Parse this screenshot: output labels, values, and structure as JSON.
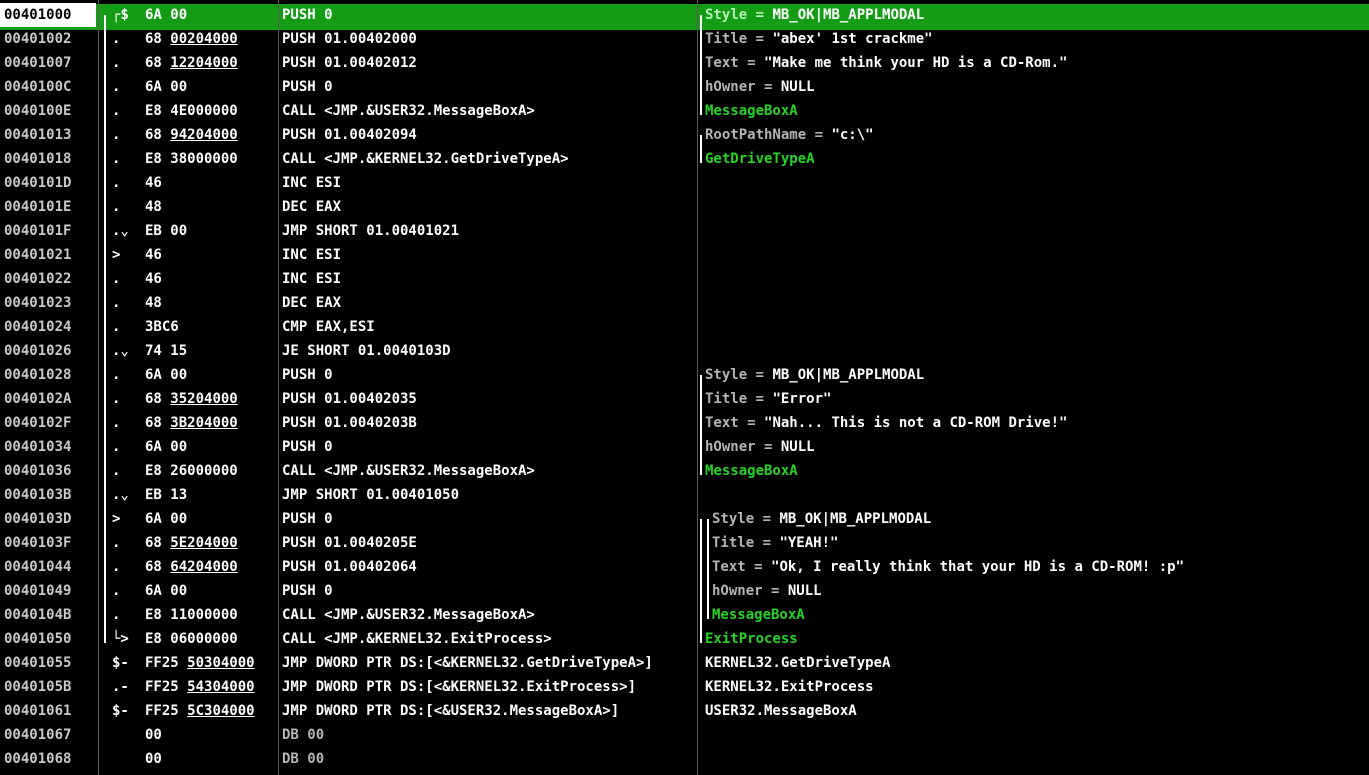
{
  "rows": [
    {
      "addr": "00401000",
      "mark": "┌$",
      "hex": "6A 00",
      "hex_u": "",
      "cmd": "PUSH 0",
      "cmt_param": "Style = ",
      "cmt_val": "MB_OK|MB_APPLMODAL",
      "cmt_fn": "",
      "selected": true
    },
    {
      "addr": "00401002",
      "mark": ".",
      "hex": "68 ",
      "hex_u": "00204000",
      "cmd": "PUSH 01.00402000",
      "cmt_param": "Title = ",
      "cmt_val": "\"abex' 1st crackme\"",
      "cmt_fn": ""
    },
    {
      "addr": "00401007",
      "mark": ".",
      "hex": "68 ",
      "hex_u": "12204000",
      "cmd": "PUSH 01.00402012",
      "cmt_param": "Text = ",
      "cmt_val": "\"Make me think your HD is a CD-Rom.\"",
      "cmt_fn": ""
    },
    {
      "addr": "0040100C",
      "mark": ".",
      "hex": "6A 00",
      "hex_u": "",
      "cmd": "PUSH 0",
      "cmt_param": "hOwner = ",
      "cmt_val": "NULL",
      "cmt_fn": ""
    },
    {
      "addr": "0040100E",
      "mark": ".",
      "hex": "E8 4E000000",
      "hex_u": "",
      "cmd": "CALL <JMP.&USER32.MessageBoxA>",
      "cmt_param": "",
      "cmt_val": "",
      "cmt_fn": "MessageBoxA"
    },
    {
      "addr": "00401013",
      "mark": ".",
      "hex": "68 ",
      "hex_u": "94204000",
      "cmd": "PUSH 01.00402094",
      "cmt_param": "RootPathName = ",
      "cmt_val": "\"c:\\\"",
      "cmt_fn": ""
    },
    {
      "addr": "00401018",
      "mark": ".",
      "hex": "E8 38000000",
      "hex_u": "",
      "cmd": "CALL <JMP.&KERNEL32.GetDriveTypeA>",
      "cmt_param": "",
      "cmt_val": "",
      "cmt_fn": "GetDriveTypeA"
    },
    {
      "addr": "0040101D",
      "mark": ".",
      "hex": "46",
      "hex_u": "",
      "cmd": "INC ESI",
      "cmt_param": "",
      "cmt_val": "",
      "cmt_fn": ""
    },
    {
      "addr": "0040101E",
      "mark": ".",
      "hex": "48",
      "hex_u": "",
      "cmd": "DEC EAX",
      "cmt_param": "",
      "cmt_val": "",
      "cmt_fn": ""
    },
    {
      "addr": "0040101F",
      "mark": ".⌄",
      "hex": "EB 00",
      "hex_u": "",
      "cmd": "JMP SHORT 01.00401021",
      "cmt_param": "",
      "cmt_val": "",
      "cmt_fn": ""
    },
    {
      "addr": "00401021",
      "mark": ">",
      "hex": "46",
      "hex_u": "",
      "cmd": "INC ESI",
      "cmt_param": "",
      "cmt_val": "",
      "cmt_fn": ""
    },
    {
      "addr": "00401022",
      "mark": ".",
      "hex": "46",
      "hex_u": "",
      "cmd": "INC ESI",
      "cmt_param": "",
      "cmt_val": "",
      "cmt_fn": ""
    },
    {
      "addr": "00401023",
      "mark": ".",
      "hex": "48",
      "hex_u": "",
      "cmd": "DEC EAX",
      "cmt_param": "",
      "cmt_val": "",
      "cmt_fn": ""
    },
    {
      "addr": "00401024",
      "mark": ".",
      "hex": "3BC6",
      "hex_u": "",
      "cmd": "CMP EAX,ESI",
      "cmt_param": "",
      "cmt_val": "",
      "cmt_fn": ""
    },
    {
      "addr": "00401026",
      "mark": ".⌄",
      "hex": "74 15",
      "hex_u": "",
      "cmd": "JE SHORT 01.0040103D",
      "cmt_param": "",
      "cmt_val": "",
      "cmt_fn": ""
    },
    {
      "addr": "00401028",
      "mark": ".",
      "hex": "6A 00",
      "hex_u": "",
      "cmd": "PUSH 0",
      "cmt_param": "Style = ",
      "cmt_val": "MB_OK|MB_APPLMODAL",
      "cmt_fn": ""
    },
    {
      "addr": "0040102A",
      "mark": ".",
      "hex": "68 ",
      "hex_u": "35204000",
      "cmd": "PUSH 01.00402035",
      "cmt_param": "Title = ",
      "cmt_val": "\"Error\"",
      "cmt_fn": ""
    },
    {
      "addr": "0040102F",
      "mark": ".",
      "hex": "68 ",
      "hex_u": "3B204000",
      "cmd": "PUSH 01.0040203B",
      "cmt_param": "Text = ",
      "cmt_val": "\"Nah... This is not a CD-ROM Drive!\"",
      "cmt_fn": ""
    },
    {
      "addr": "00401034",
      "mark": ".",
      "hex": "6A 00",
      "hex_u": "",
      "cmd": "PUSH 0",
      "cmt_param": "hOwner = ",
      "cmt_val": "NULL",
      "cmt_fn": ""
    },
    {
      "addr": "00401036",
      "mark": ".",
      "hex": "E8 26000000",
      "hex_u": "",
      "cmd": "CALL <JMP.&USER32.MessageBoxA>",
      "cmt_param": "",
      "cmt_val": "",
      "cmt_fn": "MessageBoxA"
    },
    {
      "addr": "0040103B",
      "mark": ".⌄",
      "hex": "EB 13",
      "hex_u": "",
      "cmd": "JMP SHORT 01.00401050",
      "cmt_param": "",
      "cmt_val": "",
      "cmt_fn": ""
    },
    {
      "addr": "0040103D",
      "mark": ">",
      "hex": "6A 00",
      "hex_u": "",
      "cmd": "PUSH 0",
      "cmt_param": "Style = ",
      "cmt_val": "MB_OK|MB_APPLMODAL",
      "cmt_fn": ""
    },
    {
      "addr": "0040103F",
      "mark": ".",
      "hex": "68 ",
      "hex_u": "5E204000",
      "cmd": "PUSH 01.0040205E",
      "cmt_param": "Title = ",
      "cmt_val": "\"YEAH!\"",
      "cmt_fn": ""
    },
    {
      "addr": "00401044",
      "mark": ".",
      "hex": "68 ",
      "hex_u": "64204000",
      "cmd": "PUSH 01.00402064",
      "cmt_param": "Text = ",
      "cmt_val": "\"Ok, I really think that your HD is a CD-ROM! :p\"",
      "cmt_fn": ""
    },
    {
      "addr": "00401049",
      "mark": ".",
      "hex": "6A 00",
      "hex_u": "",
      "cmd": "PUSH 0",
      "cmt_param": "hOwner = ",
      "cmt_val": "NULL",
      "cmt_fn": ""
    },
    {
      "addr": "0040104B",
      "mark": ".",
      "hex": "E8 11000000",
      "hex_u": "",
      "cmd": "CALL <JMP.&USER32.MessageBoxA>",
      "cmt_param": "",
      "cmt_val": "",
      "cmt_fn": "MessageBoxA"
    },
    {
      "addr": "00401050",
      "mark": "└>",
      "hex": "E8 06000000",
      "hex_u": "",
      "cmd": "CALL <JMP.&KERNEL32.ExitProcess>",
      "cmt_param": "",
      "cmt_val": "",
      "cmt_fn": "ExitProcess"
    },
    {
      "addr": "00401055",
      "mark": "$-",
      "hex": "FF25 ",
      "hex_u": "50304000",
      "cmd": "JMP DWORD PTR DS:[<&KERNEL32.GetDriveTypeA>]",
      "cmt_param": "",
      "cmt_val": "KERNEL32.GetDriveTypeA",
      "cmt_fn": ""
    },
    {
      "addr": "0040105B",
      "mark": ".-",
      "hex": "FF25 ",
      "hex_u": "54304000",
      "cmd": "JMP DWORD PTR DS:[<&KERNEL32.ExitProcess>]",
      "cmt_param": "",
      "cmt_val": "KERNEL32.ExitProcess",
      "cmt_fn": ""
    },
    {
      "addr": "00401061",
      "mark": "$-",
      "hex": "FF25 ",
      "hex_u": "5C304000",
      "cmd": "JMP DWORD PTR DS:[<&USER32.MessageBoxA>]",
      "cmt_param": "",
      "cmt_val": "USER32.MessageBoxA",
      "cmt_fn": ""
    },
    {
      "addr": "00401067",
      "mark": "",
      "hex": "00",
      "hex_u": "",
      "cmd": "DB 00",
      "gray": true,
      "cmt_param": "",
      "cmt_val": "",
      "cmt_fn": ""
    },
    {
      "addr": "00401068",
      "mark": "",
      "hex": "00",
      "hex_u": "",
      "cmd": "DB 00",
      "gray": true,
      "cmt_param": "",
      "cmt_val": "",
      "cmt_fn": ""
    }
  ],
  "colors": {
    "selected_bg": "#149c14",
    "function_name": "#25d325",
    "param": "#b4b4b4",
    "address": "#c8c8c8"
  }
}
